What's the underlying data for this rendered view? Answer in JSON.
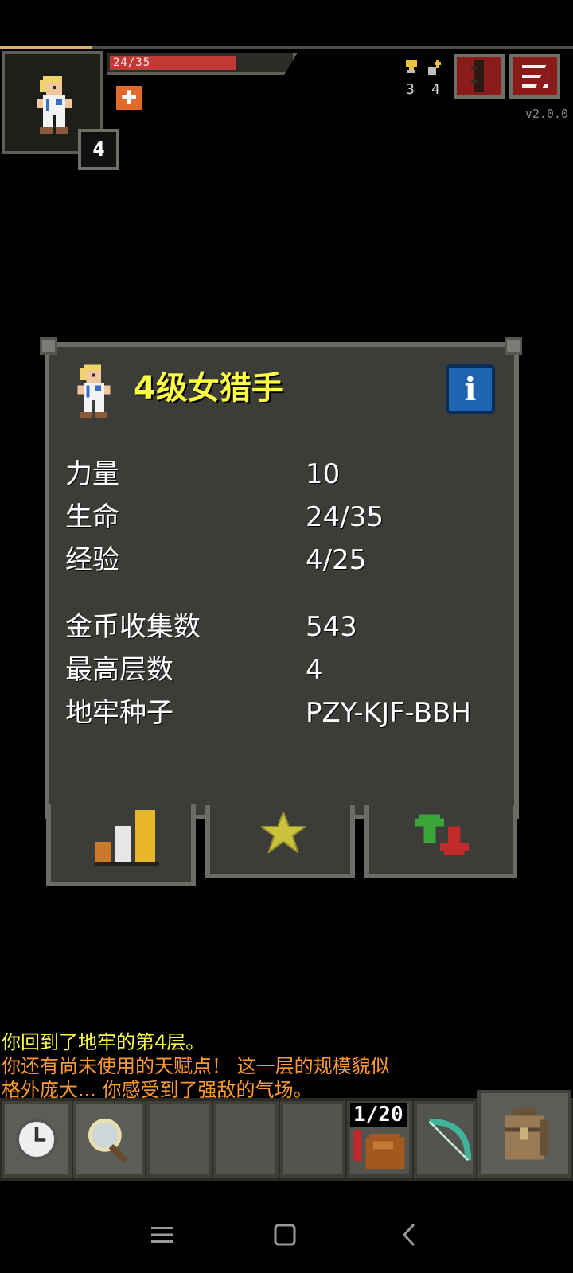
{
  "hud": {
    "hp_text": "24/35",
    "hp_fraction": 0.686,
    "hero_level": "4",
    "buff_icon": "plus-buff-icon",
    "challenges_count": "3",
    "talent_points": "4",
    "version": "v2.0.0",
    "journal_icon": "journal-icon",
    "menu_icon": "menu-icon"
  },
  "window": {
    "title": "4级女猎手",
    "info_icon": "info-icon",
    "stats": [
      {
        "label": "力量",
        "value": "10"
      },
      {
        "label": "生命",
        "value": "24/35"
      },
      {
        "label": "经验",
        "value": "4/25"
      }
    ],
    "records": [
      {
        "label": "金币收集数",
        "value": "543"
      },
      {
        "label": "最高层数",
        "value": "4"
      },
      {
        "label": "地牢种子",
        "value": "PZY-KJF-BBH"
      }
    ],
    "tabs": [
      {
        "icon": "stats-bars-icon",
        "active": true
      },
      {
        "icon": "star-icon",
        "active": false
      },
      {
        "icon": "buffs-arrows-icon",
        "active": false
      }
    ]
  },
  "log": [
    {
      "text": "你回到了地牢的第4层。",
      "color": "#ffff44"
    },
    {
      "text": "你还有尚未使用的天赋点！  这一层的规模貌似",
      "color": "#ff9a2e"
    },
    {
      "text": "格外庞大... 你感受到了强敌的气场。",
      "color": "#ff9a2e"
    }
  ],
  "toolbar": {
    "wait_icon": "clock-icon",
    "search_icon": "magnifier-icon",
    "quickslot_qty": "1/20",
    "quickslot_item_icon": "waterskin-icon",
    "bow_icon": "bow-icon",
    "backpack_icon": "backpack-icon"
  },
  "colors": {
    "hp": "#c23a36",
    "title": "#ffff44",
    "log_yellow": "#ffff44",
    "log_orange": "#ff9a2e",
    "info_blue": "#1f63b3"
  }
}
